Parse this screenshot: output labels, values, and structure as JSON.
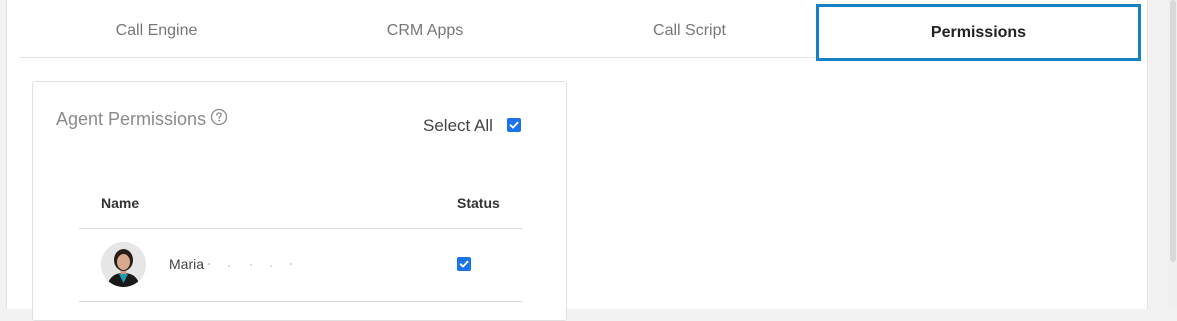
{
  "tabs": [
    {
      "label": "Call Engine",
      "active": false
    },
    {
      "label": "CRM Apps",
      "active": false
    },
    {
      "label": "Call Script",
      "active": false
    },
    {
      "label": "Permissions",
      "active": true
    }
  ],
  "panel": {
    "title": "Agent Permissions",
    "help_icon": "question-circle-icon",
    "select_all_label": "Select All",
    "select_all_checked": true
  },
  "table": {
    "columns": [
      "Name",
      "Status"
    ],
    "rows": [
      {
        "name": "Maria",
        "status_checked": true
      }
    ]
  },
  "colors": {
    "accent": "#1482c5",
    "checkbox": "#1a73e8"
  }
}
